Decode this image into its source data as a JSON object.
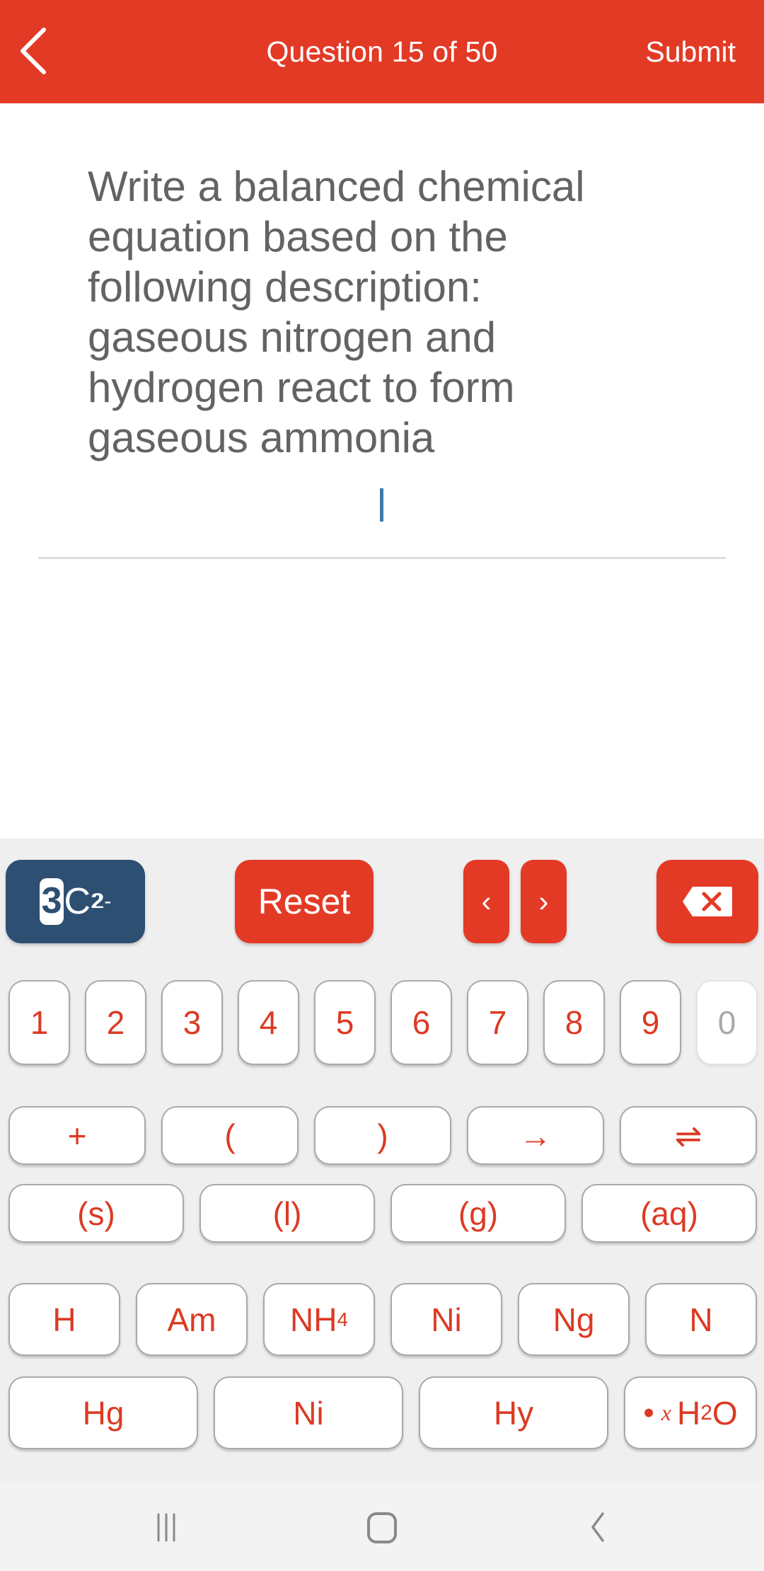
{
  "header": {
    "title": "Question 15 of 50",
    "submit_label": "Submit",
    "back_icon": "chevron-left-icon",
    "background_color": "#e33a26"
  },
  "question": {
    "text": "Write a balanced chemical equation based on the following description: gaseous nitrogen and hydrogen react to form gaseous ammonia",
    "answer_value": ""
  },
  "keyboard": {
    "mode_button": {
      "digit": "3",
      "element": "C",
      "subscript": "2",
      "superscript": "2-"
    },
    "reset_label": "Reset",
    "cursor_left_label": "‹",
    "cursor_right_label": "›",
    "backspace_icon": "backspace-icon",
    "digits": [
      "1",
      "2",
      "3",
      "4",
      "5",
      "6",
      "7",
      "8",
      "9",
      "0"
    ],
    "disabled_digits": [
      "0"
    ],
    "operators": [
      "+",
      "(",
      ")",
      "→",
      "⇌"
    ],
    "states": [
      "(s)",
      "(l)",
      "(g)",
      "(aq)"
    ],
    "elements_row1": [
      {
        "main": "H",
        "sub": ""
      },
      {
        "main": "Am",
        "sub": ""
      },
      {
        "main": "NH",
        "sub": "4"
      },
      {
        "main": "Ni",
        "sub": ""
      },
      {
        "main": "Ng",
        "sub": ""
      },
      {
        "main": "N",
        "sub": ""
      }
    ],
    "elements_row2": [
      "Hg",
      "Ni",
      "Hy"
    ],
    "hydrate": {
      "dot": "•",
      "x": "x",
      "h": "H",
      "sub": "2",
      "o": "O"
    },
    "accent_color": "#e33a26",
    "mode_color": "#2c4f72"
  },
  "system_nav": {
    "recent_apps_icon": "recent-apps-icon",
    "home_icon": "home-icon",
    "back_icon": "back-icon"
  }
}
